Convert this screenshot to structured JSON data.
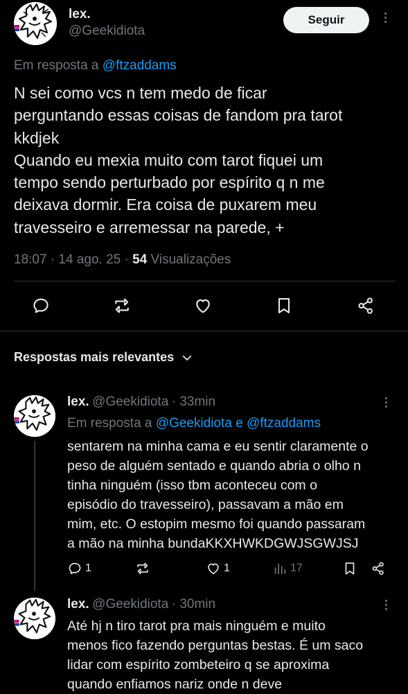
{
  "main_tweet": {
    "name": "lex.",
    "handle": "@Geekidiota",
    "follow_label": "Seguir",
    "reply_prefix": "Em resposta a",
    "reply_to": "@ftzaddams",
    "text": "N sei como vcs n tem medo de ficar\nperguntando essas coisas de fandom pra tarot\nkkdjek\nQuando eu mexia muito com tarot fiquei um\ntempo sendo perturbado por espírito q n me\ndeixava dormir. Era coisa de puxarem meu\ntravesseiro e arremessar na parede, +",
    "time": "18:07 · 14 ago. 25 ·",
    "views_count": "54",
    "views_label": "Visualizações",
    "actions": [
      "reply-icon",
      "repost-icon",
      "like-icon",
      "bookmark-icon",
      "share-icon"
    ]
  },
  "sort": {
    "label": "Respostas mais relevantes"
  },
  "replies": [
    {
      "name": "lex.",
      "handle": "@Geekidiota",
      "time": "· 33min",
      "reply_prefix": "Em resposta a",
      "reply_to_1": "@Geekidiota",
      "reply_and": "e",
      "reply_to_2": "@ftzaddams",
      "text": "sentarem na minha cama e eu sentir claramente o\npeso de alguém sentado e quando abria o olho n\ntinha ninguém (isso tbm aconteceu com o\nepisódio do travesseiro), passavam a mão em\nmim, etc. O estopim mesmo foi quando passaram\na mão na minha bundaKKXHWKDGWJSGWJSJ",
      "reply_count": "1",
      "repost_count": "",
      "like_count": "1",
      "views_count": "17"
    },
    {
      "name": "lex.",
      "handle": "@Geekidiota",
      "time": "· 30min",
      "text": "Até hj n tiro tarot pra mais ninguém e muito\nmenos fico fazendo perguntas bestas. É um saco\nlidar com espírito zombeteiro q se aproxima\nquando enfiamos nariz onde n deve"
    }
  ],
  "colors": {
    "background": "#000000",
    "text": "#e7e9ea",
    "muted": "#71767b",
    "link": "#1d9bf0",
    "divider": "#2f3336",
    "follow_bg": "#eff3f4"
  }
}
